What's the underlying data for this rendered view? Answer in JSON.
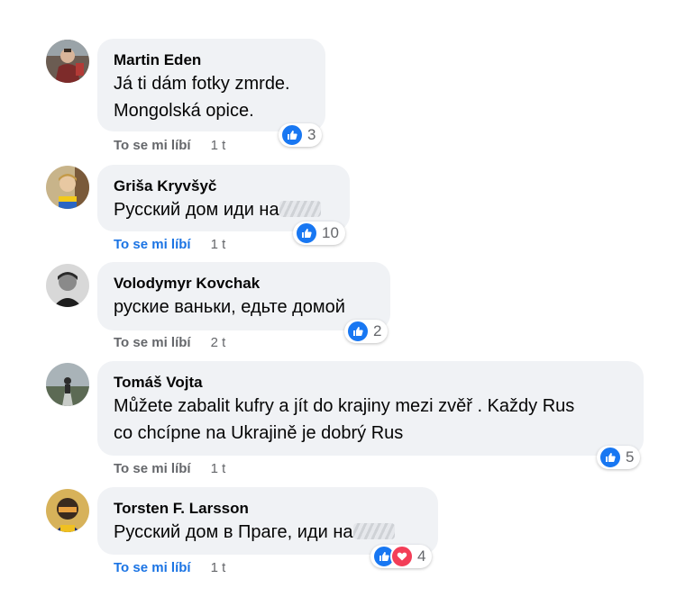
{
  "comments": [
    {
      "author": "Martin Eden",
      "text": "Já ti dám fotky zmrde.\nMongolská opice.",
      "censored_suffix": false,
      "like_label": "To se mi líbí",
      "like_active": false,
      "time": "1 t",
      "reaction_count": "3",
      "reactions": [
        "like-icon"
      ]
    },
    {
      "author": "Griša Kryvšyč",
      "text": "Русский дом иди на",
      "censored_suffix": true,
      "like_label": "To se mi líbí",
      "like_active": true,
      "time": "1 t",
      "reaction_count": "10",
      "reactions": [
        "like-icon"
      ]
    },
    {
      "author": "Volodymyr Kovchak",
      "text": "руские ваньки, едьте домой",
      "censored_suffix": false,
      "like_label": "To se mi líbí",
      "like_active": false,
      "time": "2 t",
      "reaction_count": "2",
      "reactions": [
        "like-icon"
      ]
    },
    {
      "author": "Tomáš Vojta",
      "text": "Můžete zabalit kufry a jít do krajiny mezi zvěř . Každy Rus\nco chcípne na Ukrajině je dobrý Rus",
      "censored_suffix": false,
      "like_label": "To se mi líbí",
      "like_active": false,
      "time": "1 t",
      "reaction_count": "5",
      "reactions": [
        "like-icon"
      ]
    },
    {
      "author": "Torsten F. Larsson",
      "text": "Русский дом в Праге, иди на",
      "censored_suffix": true,
      "like_label": "To se mi líbí",
      "like_active": true,
      "time": "1 t",
      "reaction_count": "4",
      "reactions": [
        "like-icon",
        "love-icon"
      ]
    }
  ],
  "colors": {
    "bubble": "#f0f2f5",
    "like_blue": "#1877f2",
    "love_red": "#f33e58",
    "active_link": "#1b74e4",
    "muted": "#65676b"
  }
}
